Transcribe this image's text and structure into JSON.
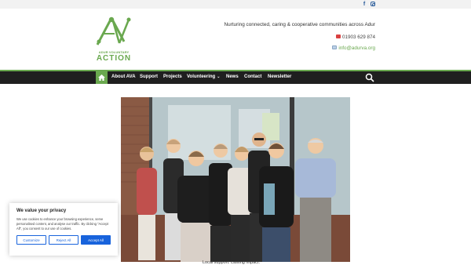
{
  "topbar": {
    "facebook_icon": "facebook-icon",
    "instagram_icon": "instagram-icon"
  },
  "logo": {
    "line1": "ADUR VOLUNTARY",
    "line2": "ACTION"
  },
  "header": {
    "tagline": "Nurturing connected, caring & cooperative communities across Adur",
    "phone": "01903 629 874",
    "email": "info@adurva.org"
  },
  "nav": {
    "items": [
      "About AVA",
      "Support",
      "Projects",
      "Volunteering",
      "News",
      "Contact",
      "Newsletter"
    ]
  },
  "colors": {
    "brand_green": "#6aa84f",
    "nav_bg": "#1f1f1f",
    "cookie_blue": "#1863dc"
  },
  "hero": {
    "caption": "Local support. Lasting impact."
  },
  "cookie": {
    "title": "We value your privacy",
    "body": "We use cookies to enhance your browsing experience, serve personalised content, and analyse our traffic. By clicking \"Accept All\", you consent to our use of cookies.",
    "customize": "Customize",
    "reject": "Reject All",
    "accept": "Accept All"
  }
}
